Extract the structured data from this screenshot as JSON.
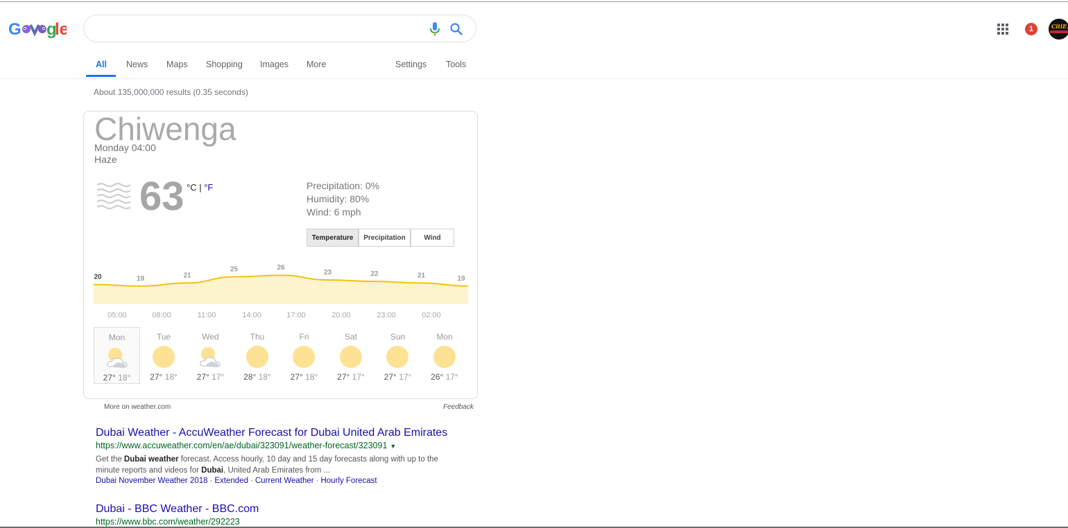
{
  "header": {
    "logo_text": "Google",
    "search_value": "",
    "notification_count": "1",
    "avatar_label": "CitiE..."
  },
  "tabs": [
    {
      "label": "All",
      "active": true
    },
    {
      "label": "News"
    },
    {
      "label": "Maps"
    },
    {
      "label": "Shopping"
    },
    {
      "label": "Images"
    },
    {
      "label": "More"
    }
  ],
  "tools": {
    "settings": "Settings",
    "tools": "Tools"
  },
  "result_stats": "About 135,000,000 results (0.35 seconds)",
  "weather": {
    "location": "Chiwenga",
    "time": "Monday 04:00",
    "condition": "Haze",
    "temperature": "63",
    "unit_c": "°C",
    "unit_sep": " | ",
    "unit_f": "°F",
    "precipitation": "Precipitation: 0%",
    "humidity": "Humidity: 80%",
    "wind": "Wind: 6 mph",
    "modes": [
      "Temperature",
      "Precipitation",
      "Wind"
    ],
    "active_mode": "Temperature",
    "more_link": "More on weather.com",
    "feedback": "Feedback"
  },
  "chart_data": {
    "type": "area",
    "x": [
      "05:00",
      "08:00",
      "11:00",
      "14:00",
      "17:00",
      "20:00",
      "23:00",
      "02:00"
    ],
    "series": [
      {
        "values": [
          20,
          19,
          21,
          25,
          26,
          23,
          22,
          21,
          19
        ]
      }
    ],
    "point_labels": [
      "20",
      "19",
      "21",
      "25",
      "26",
      "23",
      "22",
      "21",
      "19"
    ],
    "colors": {
      "line": "#f4c20d",
      "fill": "#fdf3cc"
    }
  },
  "forecast": [
    {
      "day": "Mon",
      "icon": "partly-cloudy-icon",
      "hi": "27°",
      "lo": "18°",
      "selected": true
    },
    {
      "day": "Tue",
      "icon": "sun-icon",
      "hi": "27°",
      "lo": "18°"
    },
    {
      "day": "Wed",
      "icon": "partly-cloudy-icon",
      "hi": "27°",
      "lo": "17°"
    },
    {
      "day": "Thu",
      "icon": "sun-icon",
      "hi": "28°",
      "lo": "18°"
    },
    {
      "day": "Fri",
      "icon": "sun-icon",
      "hi": "27°",
      "lo": "18°"
    },
    {
      "day": "Sat",
      "icon": "sun-icon",
      "hi": "27°",
      "lo": "17°"
    },
    {
      "day": "Sun",
      "icon": "sun-icon",
      "hi": "27°",
      "lo": "17°"
    },
    {
      "day": "Mon",
      "icon": "sun-icon",
      "hi": "26°",
      "lo": "17°"
    }
  ],
  "results": [
    {
      "title": "Dubai Weather - AccuWeather Forecast for Dubai United Arab Emirates",
      "url": "https://www.accuweather.com/en/ae/dubai/323091/weather-forecast/323091",
      "snippet_line1_pre": "Get the ",
      "snippet_b1": "Dubai weather",
      "snippet_line1_post": " forecast. Access hourly, 10 day and 15 day forecasts along with up to the",
      "snippet_line2_pre": "minute reports and videos for ",
      "snippet_b2": "Dubai",
      "snippet_line2_post": ", United Arab Emirates from ...",
      "sitelinks": [
        "Dubai November Weather 2018",
        "Extended",
        "Current Weather",
        "Hourly Forecast"
      ]
    },
    {
      "title": "Dubai - BBC Weather - BBC.com",
      "url": "https://www.bbc.com/weather/292223"
    }
  ],
  "colors": {
    "accent": "#1a73e8",
    "link": "#1a0dab",
    "url": "#006621",
    "sun": "#fde293",
    "notif": "#db4437"
  }
}
